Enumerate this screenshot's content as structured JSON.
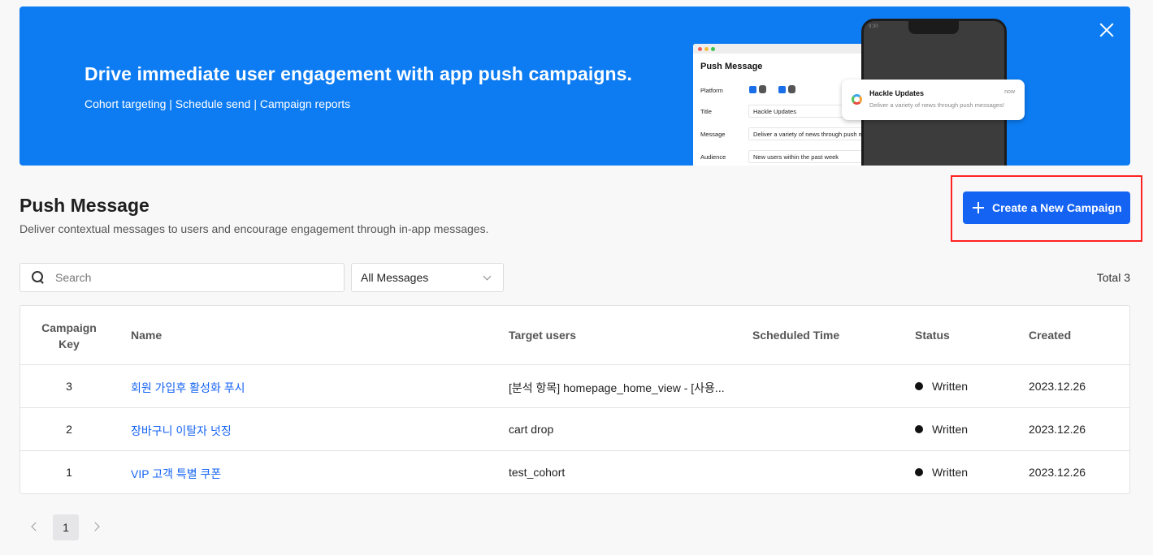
{
  "banner": {
    "title": "Drive immediate user engagement with app push campaigns.",
    "subtitle": "Cohort targeting | Schedule send | Campaign reports",
    "illustration": {
      "window_title": "Push Message",
      "platform_label": "Platform",
      "title_label": "Title",
      "title_value": "Hackle Updates",
      "message_label": "Message",
      "message_value": "Deliver a variety of news through push messages!",
      "audience_label": "Audience",
      "audience_value": "New users within the past week",
      "phone_time": "9:30",
      "notif_title": "Hackle Updates",
      "notif_time": "now",
      "notif_text": "Deliver a variety of news through push messages!"
    }
  },
  "header": {
    "title": "Push Message",
    "description": "Deliver contextual messages to users and encourage engagement through in-app messages.",
    "create_button": "Create a New Campaign"
  },
  "filters": {
    "search_placeholder": "Search",
    "select_value": "All Messages",
    "total": "Total 3"
  },
  "table": {
    "columns": {
      "key": "Campaign Key",
      "name": "Name",
      "target": "Target users",
      "scheduled": "Scheduled Time",
      "status": "Status",
      "created": "Created"
    },
    "rows": [
      {
        "key": "3",
        "name": "회원 가입후 활성화 푸시",
        "target": "[분석 항목] homepage_home_view - [사용...",
        "scheduled": "",
        "status": "Written",
        "created": "2023.12.26"
      },
      {
        "key": "2",
        "name": "장바구니 이탈자 넛징",
        "target": "cart drop",
        "scheduled": "",
        "status": "Written",
        "created": "2023.12.26"
      },
      {
        "key": "1",
        "name": "VIP 고객 특별 쿠폰",
        "target": "test_cohort",
        "scheduled": "",
        "status": "Written",
        "created": "2023.12.26"
      }
    ]
  },
  "pagination": {
    "current": "1"
  },
  "colors": {
    "banner": "#0d7cf2",
    "primary": "#1463f3",
    "highlight": "#ff2222"
  }
}
